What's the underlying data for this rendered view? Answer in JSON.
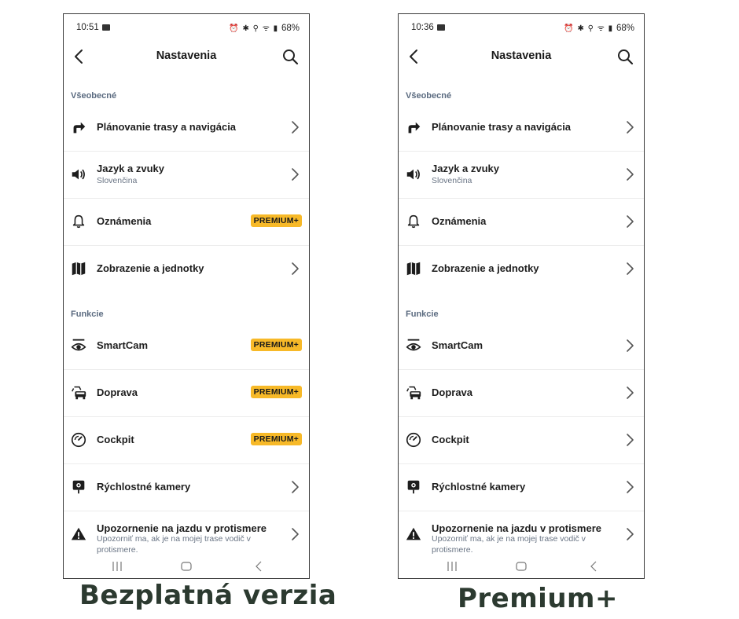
{
  "left": {
    "status": {
      "time": "10:51",
      "battery": "68%"
    },
    "title": "Nastavenia",
    "sections": [
      {
        "label": "Všeobecné"
      },
      {
        "label": "Funkcie"
      }
    ],
    "rows": [
      {
        "label": "Plánovanie trasy a navigácia",
        "icon": "turn-right-arrow-icon",
        "trailing": "chevron"
      },
      {
        "label": "Jazyk a zvuky",
        "sub": "Slovenčina",
        "icon": "speaker-icon",
        "trailing": "chevron"
      },
      {
        "label": "Oznámenia",
        "icon": "bell-icon",
        "trailing": "badge",
        "badge": "PREMIUM+"
      },
      {
        "label": "Zobrazenie a jednotky",
        "icon": "map-icon",
        "trailing": "chevron"
      },
      {
        "label": "SmartCam",
        "icon": "eye-camera-icon",
        "trailing": "badge",
        "badge": "PREMIUM+"
      },
      {
        "label": "Doprava",
        "icon": "cars-icon",
        "trailing": "badge",
        "badge": "PREMIUM+"
      },
      {
        "label": "Cockpit",
        "icon": "speedometer-icon",
        "trailing": "badge",
        "badge": "PREMIUM+"
      },
      {
        "label": "Rýchlostné kamery",
        "icon": "speed-camera-icon",
        "trailing": "chevron"
      },
      {
        "label": "Upozornenie na jazdu v protismere",
        "sub": "Upozorniť ma, ak je na mojej trase vodič v protismere.",
        "icon": "warning-icon",
        "trailing": "chevron"
      }
    ],
    "caption": "Bezplatná verzia"
  },
  "right": {
    "status": {
      "time": "10:36",
      "battery": "68%"
    },
    "title": "Nastavenia",
    "sections": [
      {
        "label": "Všeobecné"
      },
      {
        "label": "Funkcie"
      }
    ],
    "rows": [
      {
        "label": "Plánovanie trasy a navigácia",
        "icon": "turn-right-arrow-icon",
        "trailing": "chevron"
      },
      {
        "label": "Jazyk a zvuky",
        "sub": "Slovenčina",
        "icon": "speaker-icon",
        "trailing": "chevron"
      },
      {
        "label": "Oznámenia",
        "icon": "bell-icon",
        "trailing": "chevron"
      },
      {
        "label": "Zobrazenie a jednotky",
        "icon": "map-icon",
        "trailing": "chevron"
      },
      {
        "label": "SmartCam",
        "icon": "eye-camera-icon",
        "trailing": "chevron"
      },
      {
        "label": "Doprava",
        "icon": "cars-icon",
        "trailing": "chevron"
      },
      {
        "label": "Cockpit",
        "icon": "speedometer-icon",
        "trailing": "chevron"
      },
      {
        "label": "Rýchlostné kamery",
        "icon": "speed-camera-icon",
        "trailing": "chevron"
      },
      {
        "label": "Upozornenie na jazdu v protismere",
        "sub": "Upozorniť ma, ak je na mojej trase vodič v protismere.",
        "icon": "warning-icon",
        "trailing": "chevron"
      }
    ],
    "caption": "Premium+"
  },
  "colors": {
    "badge": "#f7b928",
    "section_label": "#5b6b80",
    "caption": "#2c3a30"
  }
}
